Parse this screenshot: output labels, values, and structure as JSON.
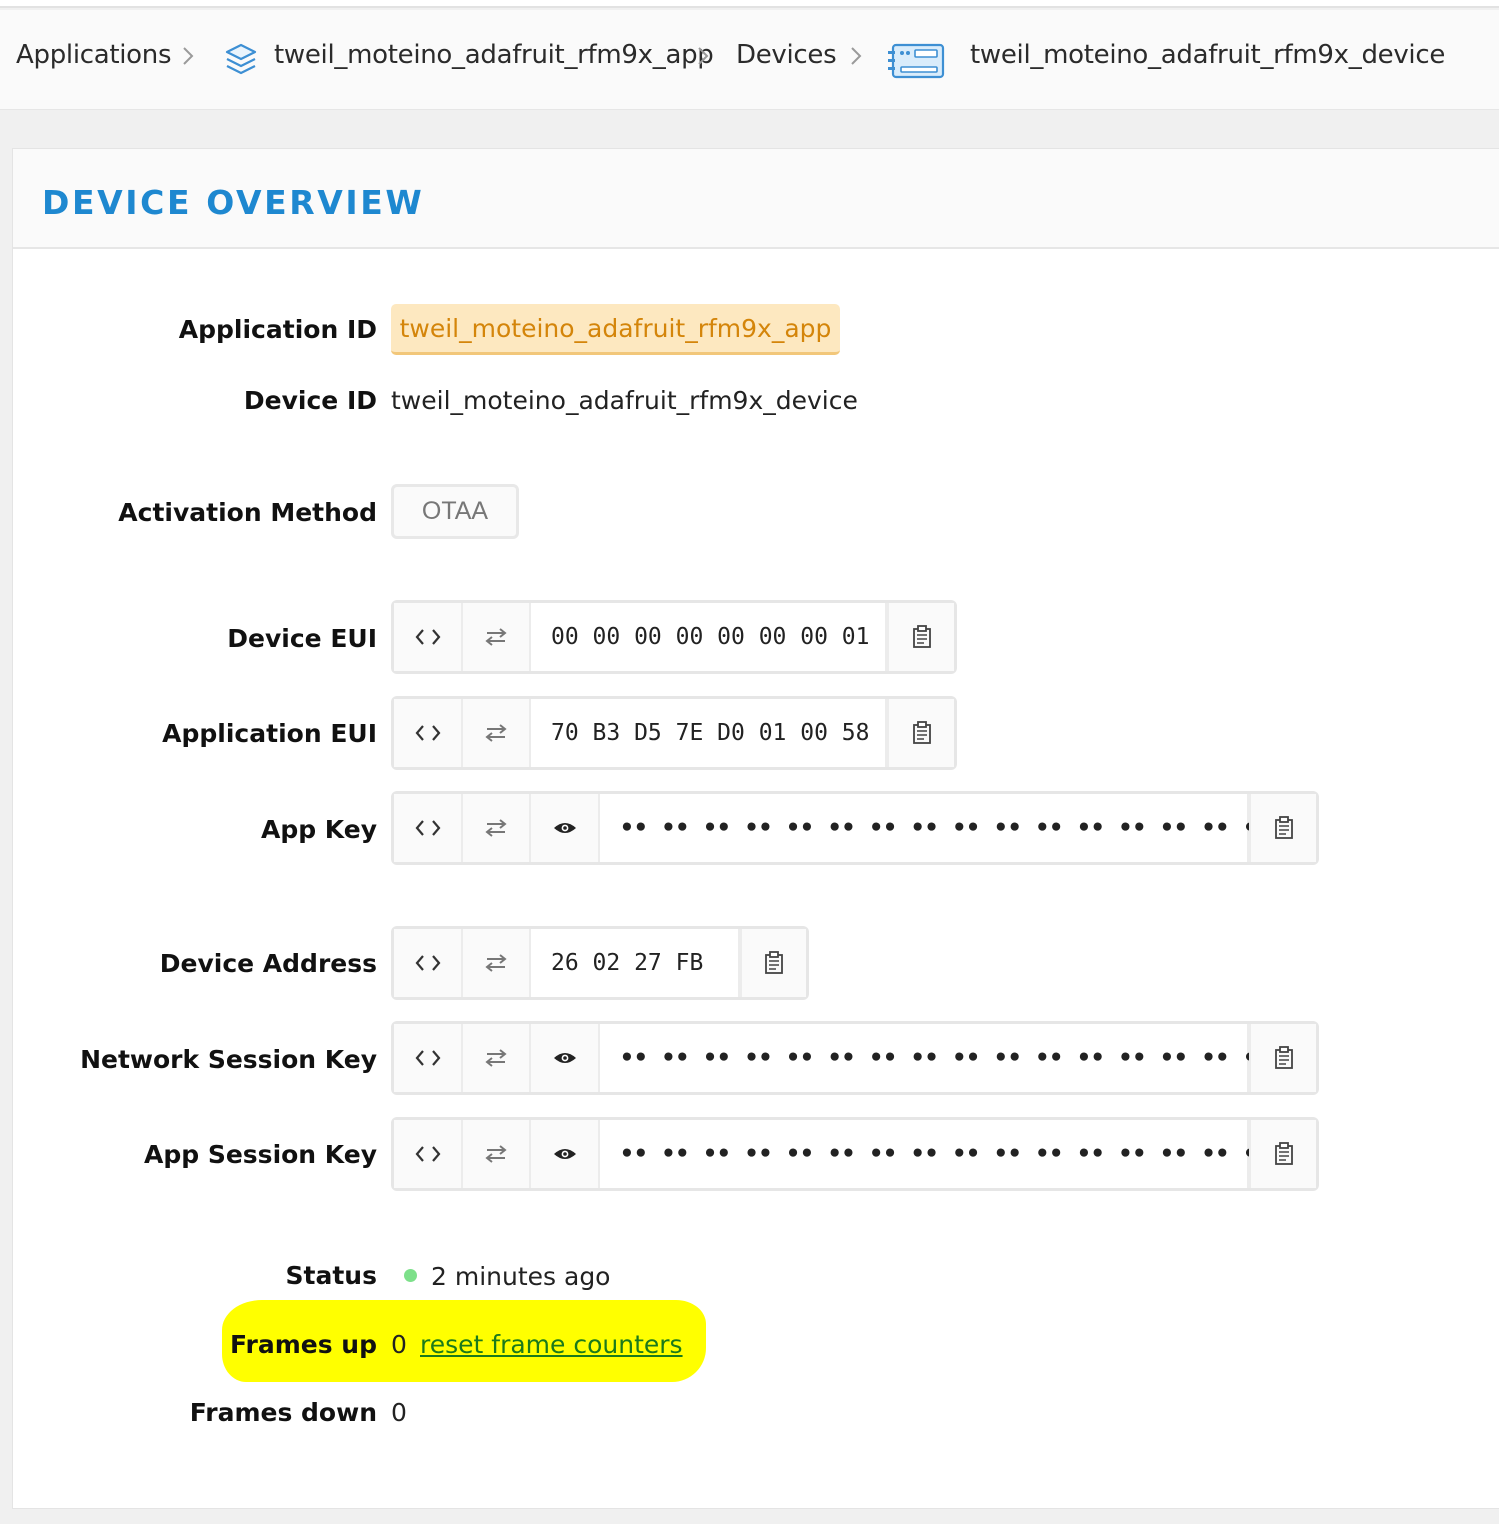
{
  "breadcrumb": {
    "applications": "Applications",
    "app": "tweil_moteino_adafruit_rfm9x_app",
    "devices": "Devices",
    "device": "tweil_moteino_adafruit_rfm9x_device"
  },
  "panel": {
    "title": "DEVICE OVERVIEW"
  },
  "fields": {
    "application_id": {
      "label": "Application ID",
      "value": "tweil_moteino_adafruit_rfm9x_app"
    },
    "device_id": {
      "label": "Device ID",
      "value": "tweil_moteino_adafruit_rfm9x_device"
    },
    "activation_method": {
      "label": "Activation Method",
      "value": "OTAA"
    },
    "device_eui": {
      "label": "Device EUI",
      "value": "00 00 00 00 00 00 00 01"
    },
    "application_eui": {
      "label": "Application EUI",
      "value": "70 B3 D5 7E D0 01 00 58"
    },
    "app_key": {
      "label": "App Key",
      "value": "•• •• •• •• •• •• •• •• •• •• •• •• •• •• •• ••"
    },
    "device_address": {
      "label": "Device Address",
      "value": "26 02 27 FB"
    },
    "network_session_key": {
      "label": "Network Session Key",
      "value": "•• •• •• •• •• •• •• •• •• •• •• •• •• •• •• ••"
    },
    "app_session_key": {
      "label": "App Session Key",
      "value": "•• •• •• •• •• •• •• •• •• •• •• •• •• •• •• ••"
    },
    "status": {
      "label": "Status",
      "value": "2 minutes ago"
    },
    "frames_up": {
      "label": "Frames up",
      "value": "0",
      "link": "reset frame counters"
    },
    "frames_down": {
      "label": "Frames down",
      "value": "0"
    }
  },
  "colors": {
    "title": "#1e88d0",
    "app_pill_bg": "#fde8c0",
    "app_pill_text": "#d4850a",
    "status_dot": "#7de08a",
    "highlight": "#ffff00",
    "link": "#1b7a1b"
  },
  "icons": [
    "chevron-right-icon",
    "layers-icon",
    "device-icon",
    "code-icon",
    "swap-icon",
    "eye-icon",
    "clipboard-icon"
  ]
}
